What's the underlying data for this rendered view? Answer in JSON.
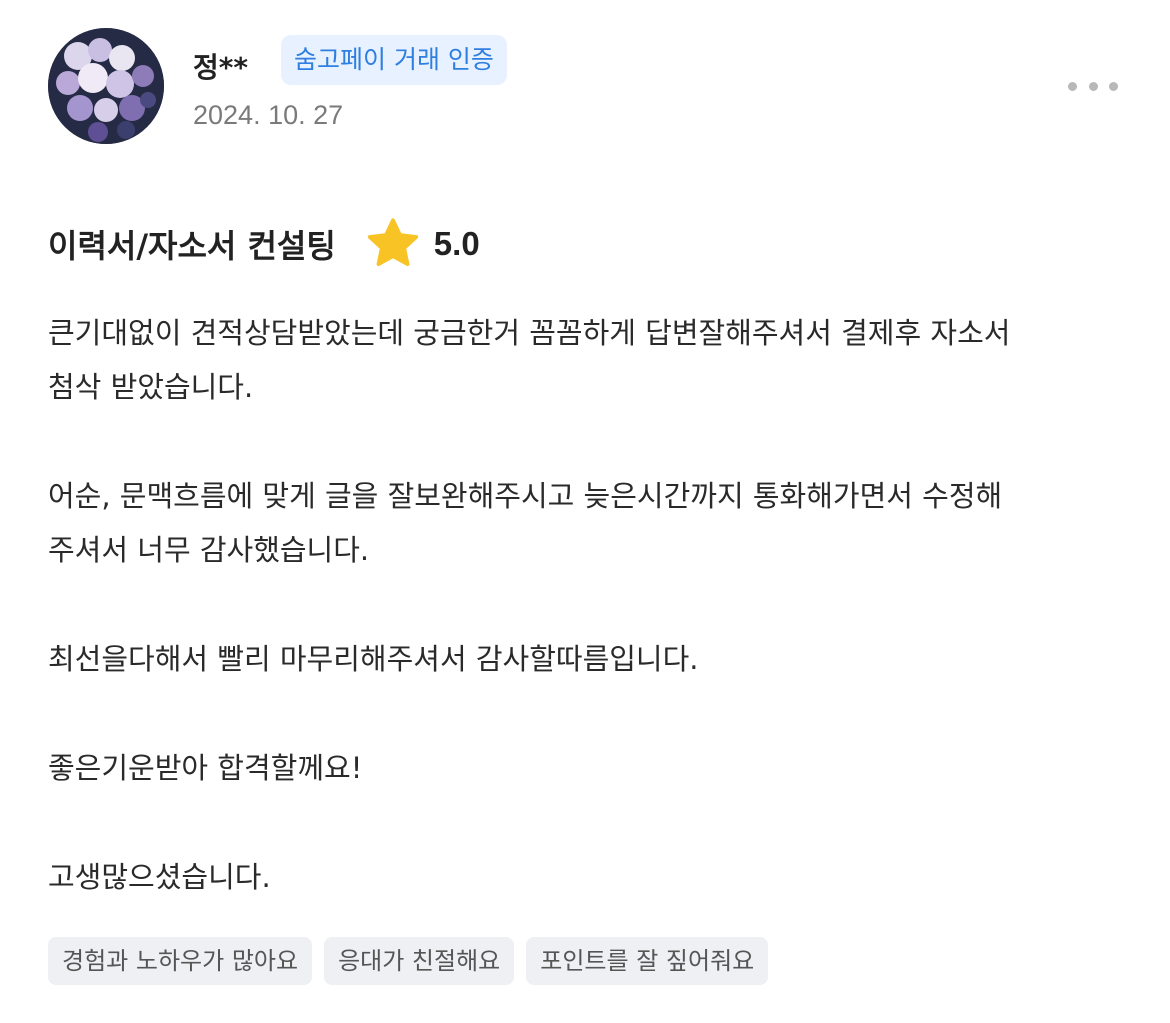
{
  "review": {
    "author_name": "정**",
    "badge_label": "숨고페이 거래 인증",
    "date": "2024. 10. 27",
    "more_icon": "more-horizontal-icon",
    "service_title": "이력서/자소서 컨설팅",
    "star_icon": "star-icon",
    "rating": "5.0",
    "paragraphs": [
      "큰기대없이 견적상담받았는데 궁금한거 꼼꼼하게 답변잘해주셔서 결제후 자소서\n첨삭 받았습니다.",
      "어순, 문맥흐름에 맞게 글을 잘보완해주시고 늦은시간까지 통화해가면서 수정해\n주셔서 너무 감사했습니다.",
      "최선을다해서 빨리 마무리해주셔서 감사할따름입니다.",
      "좋은기운받아 합격할께요!",
      "고생많으셨습니다."
    ],
    "tags": [
      "경험과 노하우가 많아요",
      "응대가 친절해요",
      "포인트를 잘 짚어줘요"
    ]
  },
  "colors": {
    "badge_bg": "#e7f1ff",
    "badge_text": "#2f7fe0",
    "star": "#f7c325",
    "tag_bg": "#eef0f3"
  }
}
